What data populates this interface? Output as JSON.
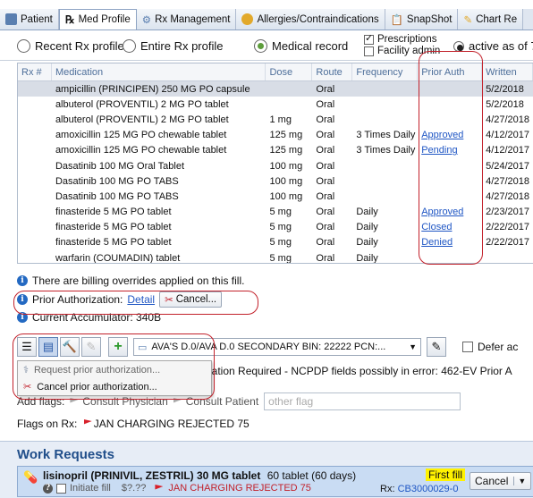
{
  "tabs": [
    {
      "label": "Patient",
      "color": "#5a7fb0"
    },
    {
      "label": "Med Profile",
      "color": "#333333",
      "active": true
    },
    {
      "label": "Rx Management",
      "color": "#5a7fb0"
    },
    {
      "label": "Allergies/Contraindications",
      "color": "#e2a92b"
    },
    {
      "label": "SnapShot",
      "color": "#4a4a4a"
    },
    {
      "label": "Chart Re",
      "color": "#e2a92b"
    }
  ],
  "filter": {
    "recent_label": "Recent Rx profile",
    "entire_label": "Entire Rx profile",
    "medical_label": "Medical record",
    "selected": "medical",
    "prescriptions_label": "Prescriptions",
    "prescriptions_checked": true,
    "facility_label": "Facility admin",
    "facility_checked": false,
    "active_label": "active as of 7"
  },
  "grid": {
    "columns": [
      "Rx #",
      "Medication",
      "Dose",
      "Route",
      "Frequency",
      "Prior Auth",
      "Written"
    ],
    "rows": [
      {
        "rx": "",
        "med": "ampicillin (PRINCIPEN) 250 MG PO capsule",
        "dose": "",
        "route": "Oral",
        "freq": "",
        "pa": "",
        "written": "5/2/2018",
        "selected": true
      },
      {
        "rx": "",
        "med": "albuterol (PROVENTIL) 2 MG PO tablet",
        "dose": "",
        "route": "Oral",
        "freq": "",
        "pa": "",
        "written": "5/2/2018"
      },
      {
        "rx": "",
        "med": "albuterol (PROVENTIL) 2 MG PO tablet",
        "dose": "1 mg",
        "route": "Oral",
        "freq": "",
        "pa": "",
        "written": "4/27/2018"
      },
      {
        "rx": "",
        "med": "amoxicillin 125 MG PO chewable tablet",
        "dose": "125 mg",
        "route": "Oral",
        "freq": "3 Times Daily",
        "pa": "Approved",
        "written": "4/12/2017"
      },
      {
        "rx": "",
        "med": "amoxicillin 125 MG PO chewable tablet",
        "dose": "125 mg",
        "route": "Oral",
        "freq": "3 Times Daily",
        "pa": "Pending",
        "written": "4/12/2017"
      },
      {
        "rx": "",
        "med": "Dasatinib 100 MG Oral Tablet",
        "dose": "100 mg",
        "route": "Oral",
        "freq": "",
        "pa": "",
        "written": "5/24/2017"
      },
      {
        "rx": "",
        "med": "Dasatinib 100 MG PO TABS",
        "dose": "100 mg",
        "route": "Oral",
        "freq": "",
        "pa": "",
        "written": "4/27/2018"
      },
      {
        "rx": "",
        "med": "Dasatinib 100 MG PO TABS",
        "dose": "100 mg",
        "route": "Oral",
        "freq": "",
        "pa": "",
        "written": "4/27/2018"
      },
      {
        "rx": "",
        "med": "finasteride 5 MG PO tablet",
        "dose": "5 mg",
        "route": "Oral",
        "freq": "Daily",
        "pa": "Approved",
        "written": "2/23/2017"
      },
      {
        "rx": "",
        "med": "finasteride 5 MG PO tablet",
        "dose": "5 mg",
        "route": "Oral",
        "freq": "Daily",
        "pa": "Closed",
        "written": "2/22/2017"
      },
      {
        "rx": "",
        "med": "finasteride 5 MG PO tablet",
        "dose": "5 mg",
        "route": "Oral",
        "freq": "Daily",
        "pa": "Denied",
        "written": "2/22/2017"
      },
      {
        "rx": "",
        "med": "warfarin (COUMADIN) tablet",
        "dose": "5 mg",
        "route": "Oral",
        "freq": "Daily",
        "pa": "",
        "written": ""
      }
    ]
  },
  "billing": {
    "overrides_text": "There are billing overrides applied on this fill.",
    "prior_auth_label": "Prior Authorization:",
    "detail_link": "Detail",
    "cancel_label": "Cancel...",
    "accumulator_text": "Current Accumulator: 340B"
  },
  "toolbar": {
    "payer_text": "AVA'S D.0/AVA D.0 SECONDARY BIN: 22222 PCN:...",
    "defer_label": "Defer ac",
    "error_text": "ization Required - NCPDP fields possibly in error: 462-EV Prior A"
  },
  "menu": {
    "request_label": "Request prior authorization...",
    "cancel_label": "Cancel prior authorization..."
  },
  "flags": {
    "add_flags_label": "Add flags:",
    "consult_physician": "Consult Physician",
    "consult_patient": "Consult Patient",
    "other_flag_placeholder": "other flag",
    "flags_on_rx_label": "Flags on Rx:",
    "flag_text": "JAN CHARGING REJECTED 75"
  },
  "work_requests": {
    "title": "Work Requests",
    "item_title": "lisinopril (PRINIVIL, ZESTRIL) 30 MG tablet",
    "item_qty": "60 tablet (60 days)",
    "badge": "First fill",
    "cancel_label": "Cancel",
    "initiate_label": "Initiate fill",
    "price": "$?.??",
    "flag_text": "JAN CHARGING REJECTED 75",
    "rx_label": "Rx:",
    "rx_number": "CB3000029-0"
  }
}
